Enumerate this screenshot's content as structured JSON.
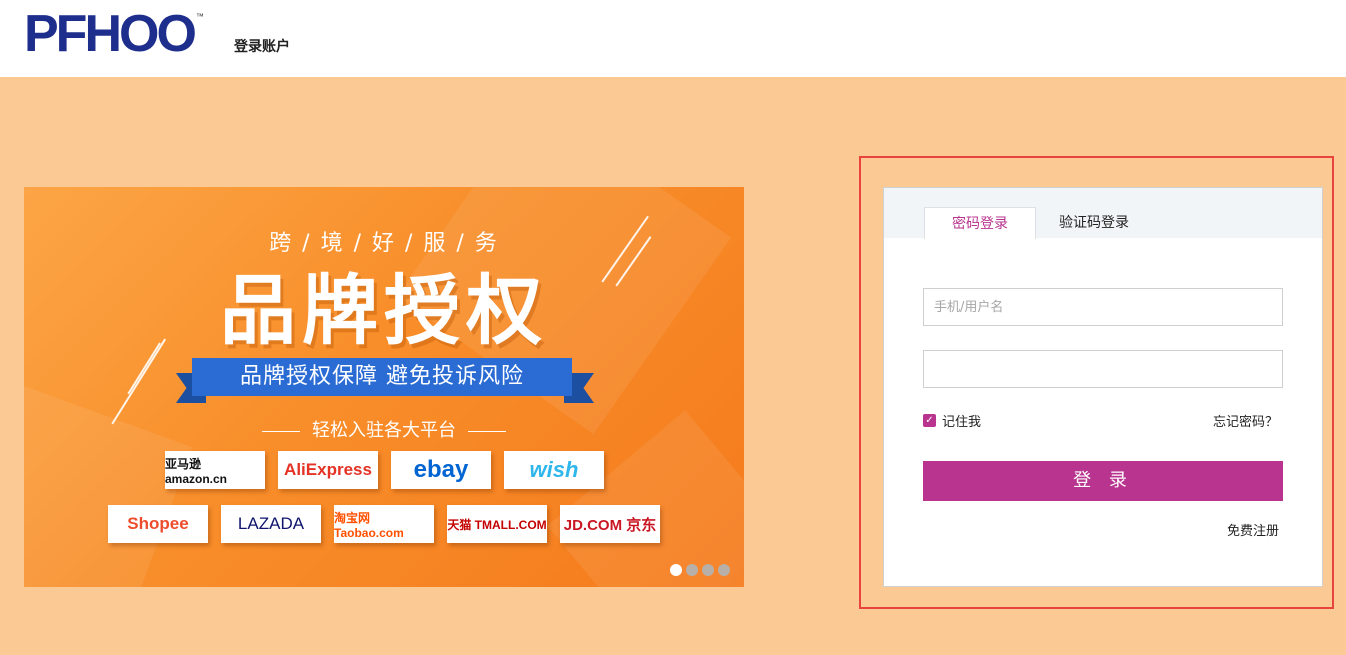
{
  "header": {
    "logo": "PFHOO",
    "logo_tm": "™",
    "title": "登录账户"
  },
  "banner": {
    "subtitle": "跨 / 境 / 好 / 服 / 务",
    "title": "品牌授权",
    "ribbon": "品牌授权保障  避免投诉风险",
    "platforms_label": "轻松入驻各大平台",
    "platforms": [
      {
        "name": "amazon",
        "text": "亚马逊 amazon.cn",
        "color": "#111111"
      },
      {
        "name": "aliexpress",
        "text": "AliExpress",
        "color": "#e43225"
      },
      {
        "name": "ebay",
        "text": "ebay",
        "color": "#0064d2"
      },
      {
        "name": "wish",
        "text": "wish",
        "color": "#2fb7ec"
      },
      {
        "name": "shopee",
        "text": "Shopee",
        "color": "#ee4d2d"
      },
      {
        "name": "lazada",
        "text": "LAZADA",
        "color": "#0f146d"
      },
      {
        "name": "taobao",
        "text": "淘宝网 Taobao.com",
        "color": "#ff5000"
      },
      {
        "name": "tmall",
        "text": "天猫 TMALL.COM",
        "color": "#c40000"
      },
      {
        "name": "jd",
        "text": "JD.COM 京东",
        "color": "#c91623"
      }
    ],
    "carousel": {
      "count": 4,
      "active": 0
    }
  },
  "login": {
    "tabs": [
      {
        "label": "密码登录",
        "active": true
      },
      {
        "label": "验证码登录",
        "active": false
      }
    ],
    "username_placeholder": "手机/用户名",
    "password_placeholder": "",
    "remember_label": "记住我",
    "remember_checked": true,
    "forgot_label": "忘记密码？",
    "submit_label": "登 录",
    "register_label": "免费注册"
  },
  "colors": {
    "page_bg": "#fac994",
    "accent": "#b8348f",
    "highlight_border": "#e8433c",
    "logo_blue": "#1e2e8c"
  }
}
